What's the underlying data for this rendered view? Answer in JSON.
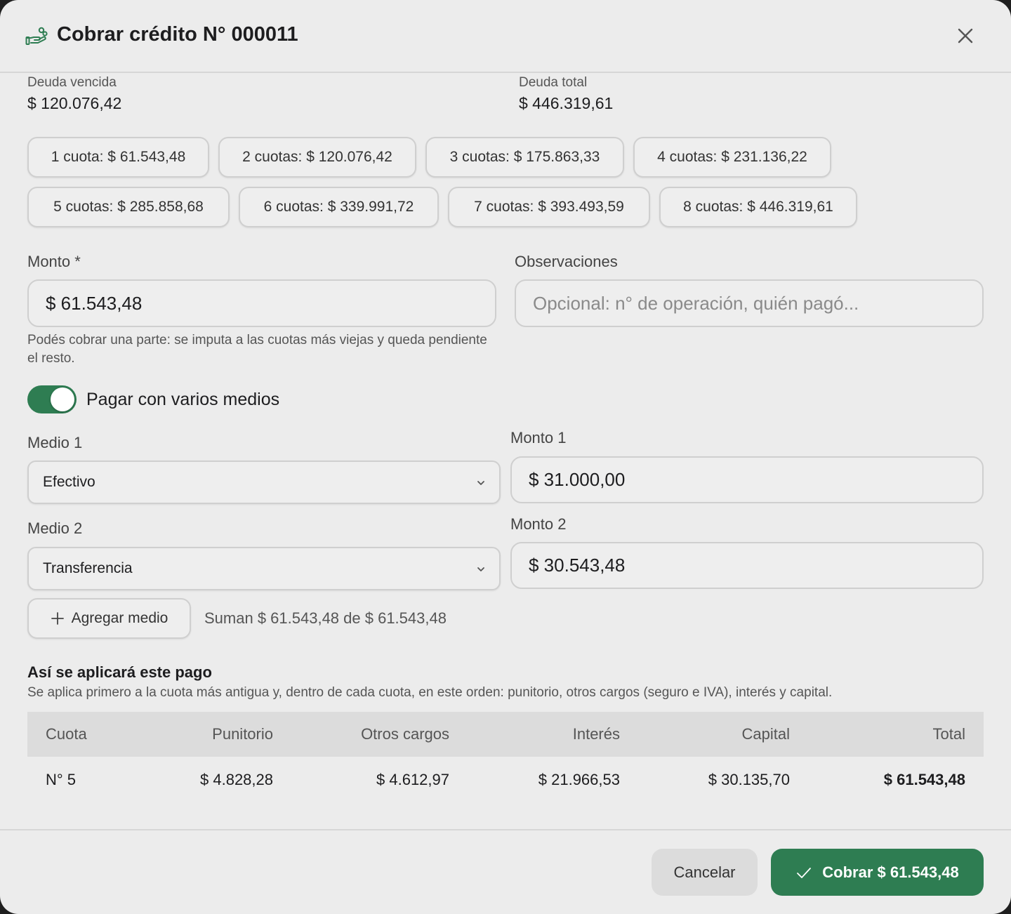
{
  "header": {
    "icon": "hand-coins-icon",
    "title": "Cobrar crédito N° 000011",
    "close_icon": "close-icon"
  },
  "summary": {
    "overdue_label": "Deuda vencida",
    "overdue_value": "$ 120.076,42",
    "total_label": "Deuda total",
    "total_value": "$ 446.319,61"
  },
  "installments": [
    "1 cuota: $ 61.543,48",
    "2 cuotas: $ 120.076,42",
    "3 cuotas: $ 175.863,33",
    "4 cuotas: $ 231.136,22",
    "5 cuotas: $ 285.858,68",
    "6 cuotas: $ 339.991,72",
    "7 cuotas: $ 393.493,59",
    "8 cuotas: $ 446.319,61"
  ],
  "amount": {
    "label": "Monto *",
    "value": "$ 61.543,48",
    "help": "Podés cobrar una parte: se imputa a las cuotas más viejas y queda pendiente el resto."
  },
  "notes": {
    "label": "Observaciones",
    "placeholder": "Opcional: n° de operación, quién pagó..."
  },
  "multi_pay": {
    "label": "Pagar con varios medios",
    "enabled": true
  },
  "methods": [
    {
      "method_label": "Medio 1",
      "method_value": "Efectivo",
      "amount_label": "Monto 1",
      "amount_value": "$ 31.000,00"
    },
    {
      "method_label": "Medio 2",
      "method_value": "Transferencia",
      "amount_label": "Monto 2",
      "amount_value": "$ 30.543,48"
    }
  ],
  "add_method_label": "Agregar medio",
  "sum_text": "Suman $ 61.543,48 de $ 61.543,48",
  "application": {
    "title": "Así se aplicará este pago",
    "description": "Se aplica primero a la cuota más antigua y, dentro de cada cuota, en este orden: punitorio, otros cargos (seguro e IVA), interés y capital.",
    "columns": [
      "Cuota",
      "Punitorio",
      "Otros cargos",
      "Interés",
      "Capital",
      "Total"
    ],
    "rows": [
      [
        "N° 5",
        "$ 4.828,28",
        "$ 4.612,97",
        "$ 21.966,53",
        "$ 30.135,70",
        "$ 61.543,48"
      ]
    ]
  },
  "footer": {
    "cancel_label": "Cancelar",
    "confirm_label": "Cobrar $ 61.543,48"
  },
  "colors": {
    "accent": "#2e7d52",
    "background": "#ececec"
  }
}
